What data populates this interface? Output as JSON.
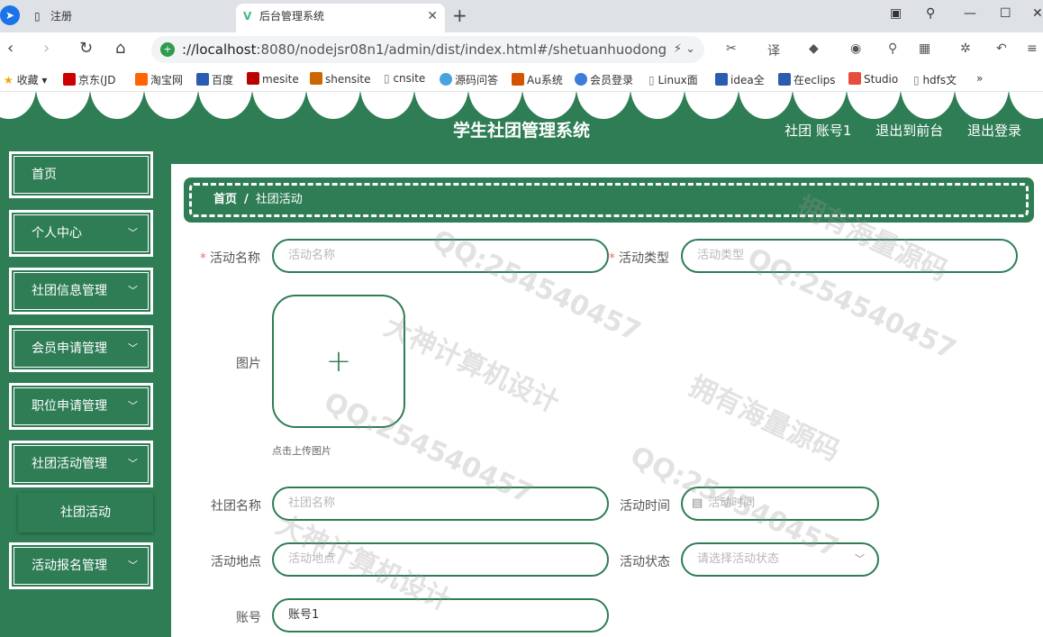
{
  "browser": {
    "tabs": [
      {
        "label": "注册"
      },
      {
        "label": "后台管理系统"
      }
    ],
    "url_prefix": "://localhost",
    "url_rest": ":8080/nodejsr08n1/admin/dist/index.html#/shetuanhuodong",
    "bookmarks": [
      "收藏",
      "京东(JD",
      "淘宝网",
      "百度",
      "mesite",
      "shensite",
      "cnsite",
      "源码问答",
      "Au系统",
      "会员登录",
      "Linux面",
      "idea全",
      "在eclips",
      "Studio",
      "hdfs文"
    ]
  },
  "header": {
    "title": "学生社团管理系统",
    "user": "社团 账号1",
    "to_front": "退出到前台",
    "logout": "退出登录"
  },
  "sidebar": {
    "items": [
      {
        "label": "首页"
      },
      {
        "label": "个人中心"
      },
      {
        "label": "社团信息管理"
      },
      {
        "label": "会员申请管理"
      },
      {
        "label": "职位申请管理"
      },
      {
        "label": "社团活动管理"
      },
      {
        "label": "社团活动"
      },
      {
        "label": "活动报名管理"
      }
    ]
  },
  "breadcrumb": {
    "home": "首页",
    "sep": "/",
    "current": "社团活动"
  },
  "form": {
    "activity_name": {
      "label": "活动名称",
      "placeholder": "活动名称"
    },
    "activity_type": {
      "label": "活动类型",
      "placeholder": "活动类型"
    },
    "image": {
      "label": "图片",
      "tip": "点击上传图片"
    },
    "club_name": {
      "label": "社团名称",
      "placeholder": "社团名称"
    },
    "activity_time": {
      "label": "活动时间",
      "placeholder": "活动时间"
    },
    "location": {
      "label": "活动地点",
      "placeholder": "活动地点"
    },
    "status": {
      "label": "活动状态",
      "placeholder": "请选择活动状态"
    },
    "account": {
      "label": "账号",
      "value": "账号1"
    }
  },
  "watermark": {
    "qq": "QQ:254540457",
    "slogan1": "拥有海量源码",
    "slogan2": "大神计算机设计"
  },
  "colors": {
    "primary": "#2e7d55"
  }
}
